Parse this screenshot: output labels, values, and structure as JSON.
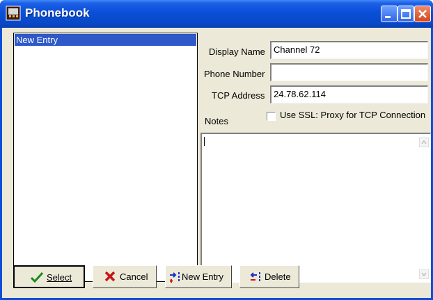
{
  "window": {
    "title": "Phonebook"
  },
  "entries": [
    "New Entry"
  ],
  "form": {
    "display_name_label": "Display Name",
    "display_name_value": "Channel 72",
    "phone_number_label": "Phone Number",
    "phone_number_value": "",
    "tcp_address_label": "TCP Address",
    "tcp_address_value": "24.78.62.114",
    "use_ssl_label": "Use SSL: Proxy for TCP Connection",
    "use_ssl_checked": false,
    "notes_label": "Notes",
    "notes_value": ""
  },
  "buttons": {
    "select": "Select",
    "cancel": "Cancel",
    "new_entry": "New Entry",
    "delete": "Delete"
  },
  "icons": {
    "app": "phonebook-app-icon",
    "select": "checkmark-icon",
    "cancel": "x-icon",
    "new_entry": "add-entry-icon",
    "delete": "delete-entry-icon"
  },
  "colors": {
    "titlebar": "#0a4fd8",
    "selection": "#2f59c8",
    "face": "#ece9d8"
  }
}
